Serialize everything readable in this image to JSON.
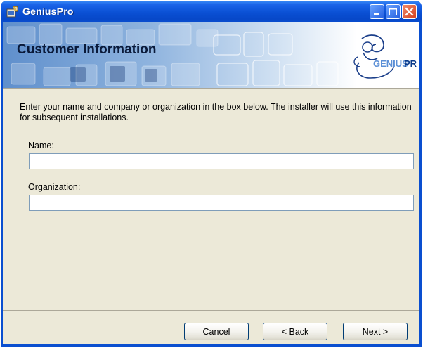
{
  "window": {
    "title": "GeniusPro",
    "controls": {
      "minimize": "minimize-icon",
      "maximize": "maximize-icon",
      "close": "close-icon"
    }
  },
  "banner": {
    "title": "Customer Information",
    "logo_text": "GENIUSPRO",
    "logo_colors": {
      "genius": "#4f86d0",
      "pro": "#0a3a8a"
    }
  },
  "body": {
    "description": "Enter your name and company or organization in the box below. The installer will use this information for subsequent installations."
  },
  "form": {
    "name_label": "Name:",
    "name_value": "",
    "organization_label": "Organization:",
    "organization_value": ""
  },
  "buttons": {
    "cancel": "Cancel",
    "back": "< Back",
    "next": "Next >"
  },
  "colors": {
    "titlebar": "#0a50d4",
    "dialog_bg": "#ece9d8",
    "button_border": "#003c74"
  }
}
